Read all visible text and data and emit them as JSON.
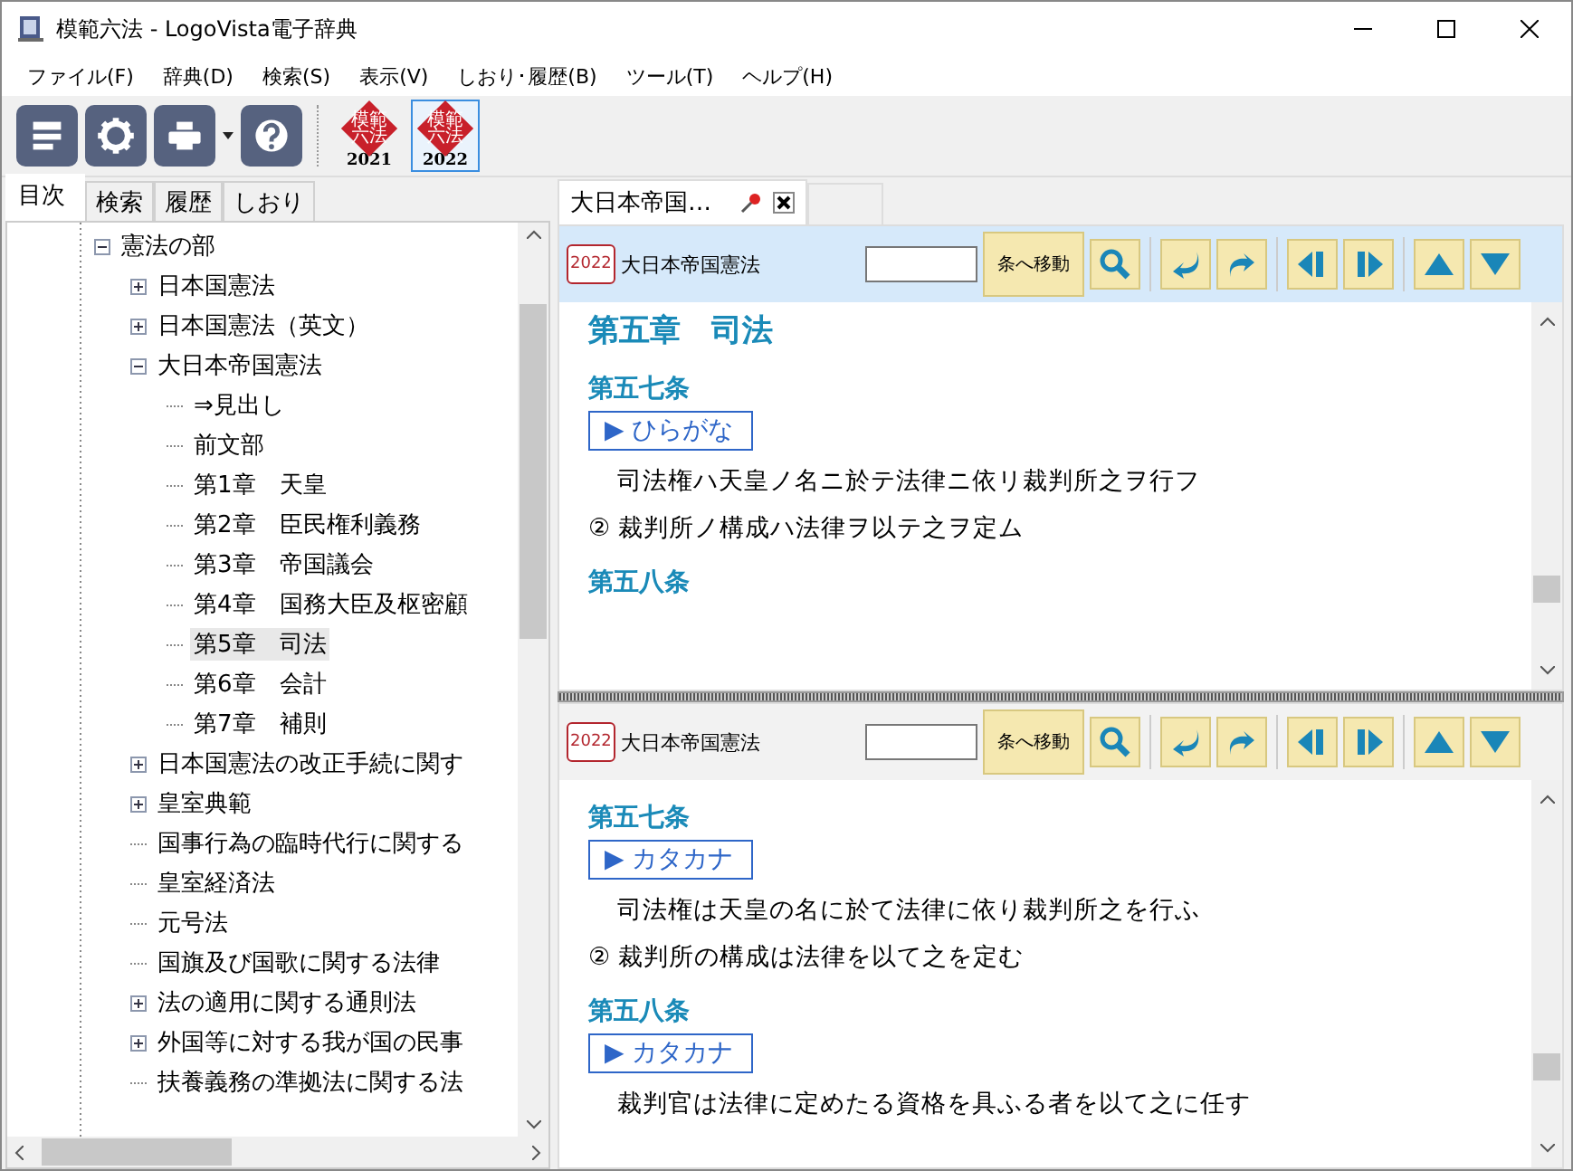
{
  "window": {
    "title": "模範六法 - LogoVista電子辞典"
  },
  "menu": [
    "ファイル(F)",
    "辞典(D)",
    "検索(S)",
    "表示(V)",
    "しおり･履歴(B)",
    "ツール(T)",
    "ヘルプ(H)"
  ],
  "editions": [
    {
      "logo_text": "模範六法",
      "year": "2021",
      "selected": false
    },
    {
      "logo_text": "模範六法",
      "year": "2022",
      "selected": true
    }
  ],
  "side_tabs": [
    {
      "label": "目次",
      "selected": true
    },
    {
      "label": "検索",
      "selected": false
    },
    {
      "label": "履歴",
      "selected": false
    },
    {
      "label": "しおり",
      "selected": false
    }
  ],
  "tree": [
    {
      "label": "憲法の部",
      "expanded": true,
      "selected": false,
      "children": [
        {
          "label": "日本国憲法",
          "expanded": false,
          "selected": false
        },
        {
          "label": "日本国憲法（英文）",
          "expanded": false,
          "selected": false
        },
        {
          "label": "大日本帝国憲法",
          "expanded": true,
          "selected": false,
          "children": [
            {
              "label": "⇒見出し",
              "selected": false
            },
            {
              "label": "前文部",
              "selected": false
            },
            {
              "label": "第1章　天皇",
              "selected": false
            },
            {
              "label": "第2章　臣民権利義務",
              "selected": false
            },
            {
              "label": "第3章　帝国議会",
              "selected": false
            },
            {
              "label": "第4章　国務大臣及枢密顧",
              "selected": false
            },
            {
              "label": "第5章　司法",
              "selected": true
            },
            {
              "label": "第6章　会計",
              "selected": false
            },
            {
              "label": "第7章　補則",
              "selected": false
            }
          ]
        },
        {
          "label": "日本国憲法の改正手続に関す",
          "expanded": false,
          "selected": false
        },
        {
          "label": "皇室典範",
          "expanded": false,
          "selected": false
        },
        {
          "label": "国事行為の臨時代行に関する",
          "selected": false
        },
        {
          "label": "皇室経済法",
          "selected": false
        },
        {
          "label": "元号法",
          "selected": false
        },
        {
          "label": "国旗及び国歌に関する法律",
          "selected": false
        },
        {
          "label": "法の適用に関する通則法",
          "expanded": false,
          "selected": false
        },
        {
          "label": "外国等に対する我が国の民事",
          "expanded": false,
          "selected": false
        },
        {
          "label": "扶養義務の準拠法に関する法",
          "selected": false
        }
      ]
    }
  ],
  "doc_tab": {
    "label": "大日本帝国…"
  },
  "panes": [
    {
      "active": true,
      "badge": "2022",
      "title": "大日本帝国憲法",
      "jump_button": "条へ移動",
      "content": [
        {
          "kind": "chapter",
          "text": "第五章　司法"
        },
        {
          "kind": "article",
          "text": "第五七条"
        },
        {
          "kind": "toggle",
          "text": "▶ ひらがな"
        },
        {
          "kind": "para",
          "text": "司法権ハ天皇ノ名ニ於テ法律ニ依リ裁判所之ヲ行フ"
        },
        {
          "kind": "numbered",
          "text": "② 裁判所ノ構成ハ法律ヲ以テ之ヲ定ム"
        },
        {
          "kind": "article",
          "text": "第五八条"
        }
      ]
    },
    {
      "active": false,
      "badge": "2022",
      "title": "大日本帝国憲法",
      "jump_button": "条へ移動",
      "content": [
        {
          "kind": "article",
          "text": "第五七条"
        },
        {
          "kind": "toggle",
          "text": "▶ カタカナ"
        },
        {
          "kind": "para",
          "text": "司法権は天皇の名に於て法律に依り裁判所之を行ふ"
        },
        {
          "kind": "numbered",
          "text": "② 裁判所の構成は法律を以て之を定む"
        },
        {
          "kind": "article",
          "text": "第五八条"
        },
        {
          "kind": "toggle",
          "text": "▶ カタカナ"
        },
        {
          "kind": "para",
          "text": "裁判官は法律に定めたる資格を具ふる者を以て之に任す"
        }
      ]
    }
  ]
}
